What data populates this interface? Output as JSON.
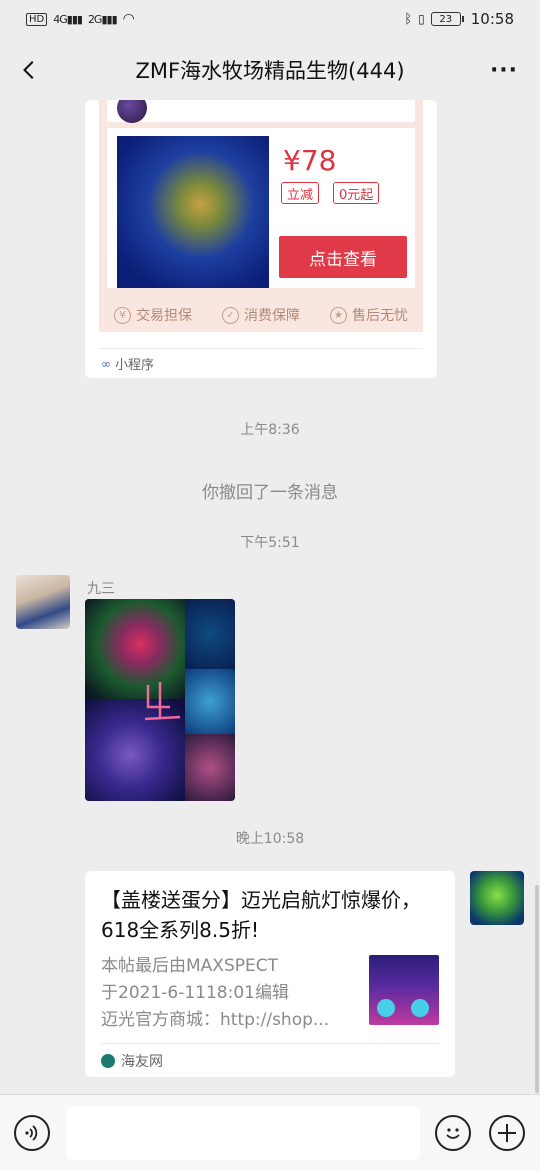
{
  "status_bar": {
    "left_signal_1": "4G",
    "left_signal_2": "2G",
    "battery": "23",
    "time": "10:58"
  },
  "header": {
    "title": "ZMF海水牧场精品生物(444)",
    "more_label": "···"
  },
  "mini_program_card": {
    "price": "¥78",
    "tag_1": "立减",
    "tag_2": "0元起",
    "button_label": "点击查看",
    "guarantees": [
      "交易担保",
      "消费保障",
      "售后无忧"
    ],
    "footer_label": "小程序"
  },
  "messages": {
    "timestamp_1": "上午8:36",
    "system_recall": "你撤回了一条消息",
    "timestamp_2": "下午5:51",
    "sender_name": "九三",
    "timestamp_3": "晚上10:58"
  },
  "link_card": {
    "title": "【盖楼送蛋分】迈光启航灯惊爆价，618全系列8.5折!",
    "desc_line_1": "本帖最后由MAXSPECT",
    "desc_line_2": "于2021-6-1118:01编辑",
    "desc_line_3": "迈光官方商城：http://shop...",
    "source": "海友网"
  },
  "input_bar": {
    "placeholder": ""
  },
  "colors": {
    "accent_red": "#e03a48",
    "background": "#ededed"
  }
}
